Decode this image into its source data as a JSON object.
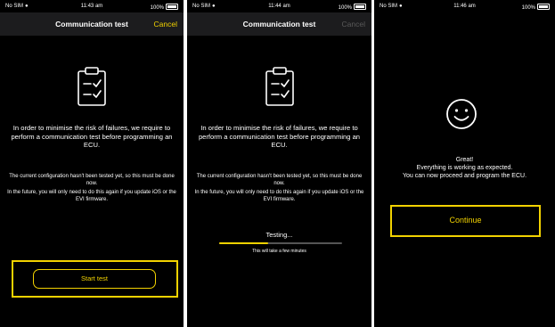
{
  "colors": {
    "accent": "#f2d200",
    "background": "#000000",
    "navbar": "#1c1c1e",
    "disabled": "#5a5a5a"
  },
  "screens": [
    {
      "status": {
        "carrier": "No SIM",
        "time": "11:43 am",
        "battery": "100%"
      },
      "nav": {
        "title": "Communication test",
        "cancel": "Cancel",
        "cancel_enabled": true
      },
      "icon": "clipboard-checklist-icon",
      "main_text": "In order to minimise the risk of failures, we require to perform a communication test before programming an ECU.",
      "note1": "The current configuration hasn't been tested yet, so this must be done now.",
      "note2": "In the future, you will only need to do this again if you update iOS or the EVI firmware.",
      "button": "Start test"
    },
    {
      "status": {
        "carrier": "No SIM",
        "time": "11:44 am",
        "battery": "100%"
      },
      "nav": {
        "title": "Communication test",
        "cancel": "Cancel",
        "cancel_enabled": false
      },
      "icon": "clipboard-checklist-icon",
      "main_text": "In order to minimise the risk of failures, we require to perform a communication test before programming an ECU.",
      "note1": "The current configuration hasn't been tested yet, so this must be done now.",
      "note2": "In the future, you will only need to do this again if you update iOS or the EVI firmware.",
      "testing_label": "Testing...",
      "testing_progress": 0.4,
      "testing_sub": "This will take a few minutes"
    },
    {
      "status": {
        "carrier": "No SIM",
        "time": "11:46 am",
        "battery": "100%"
      },
      "icon": "smiley-face-icon",
      "success_line1": "Great!",
      "success_line2": "Everything is working as expected.",
      "success_line3": "You can now proceed and program the ECU.",
      "button": "Continue"
    }
  ]
}
